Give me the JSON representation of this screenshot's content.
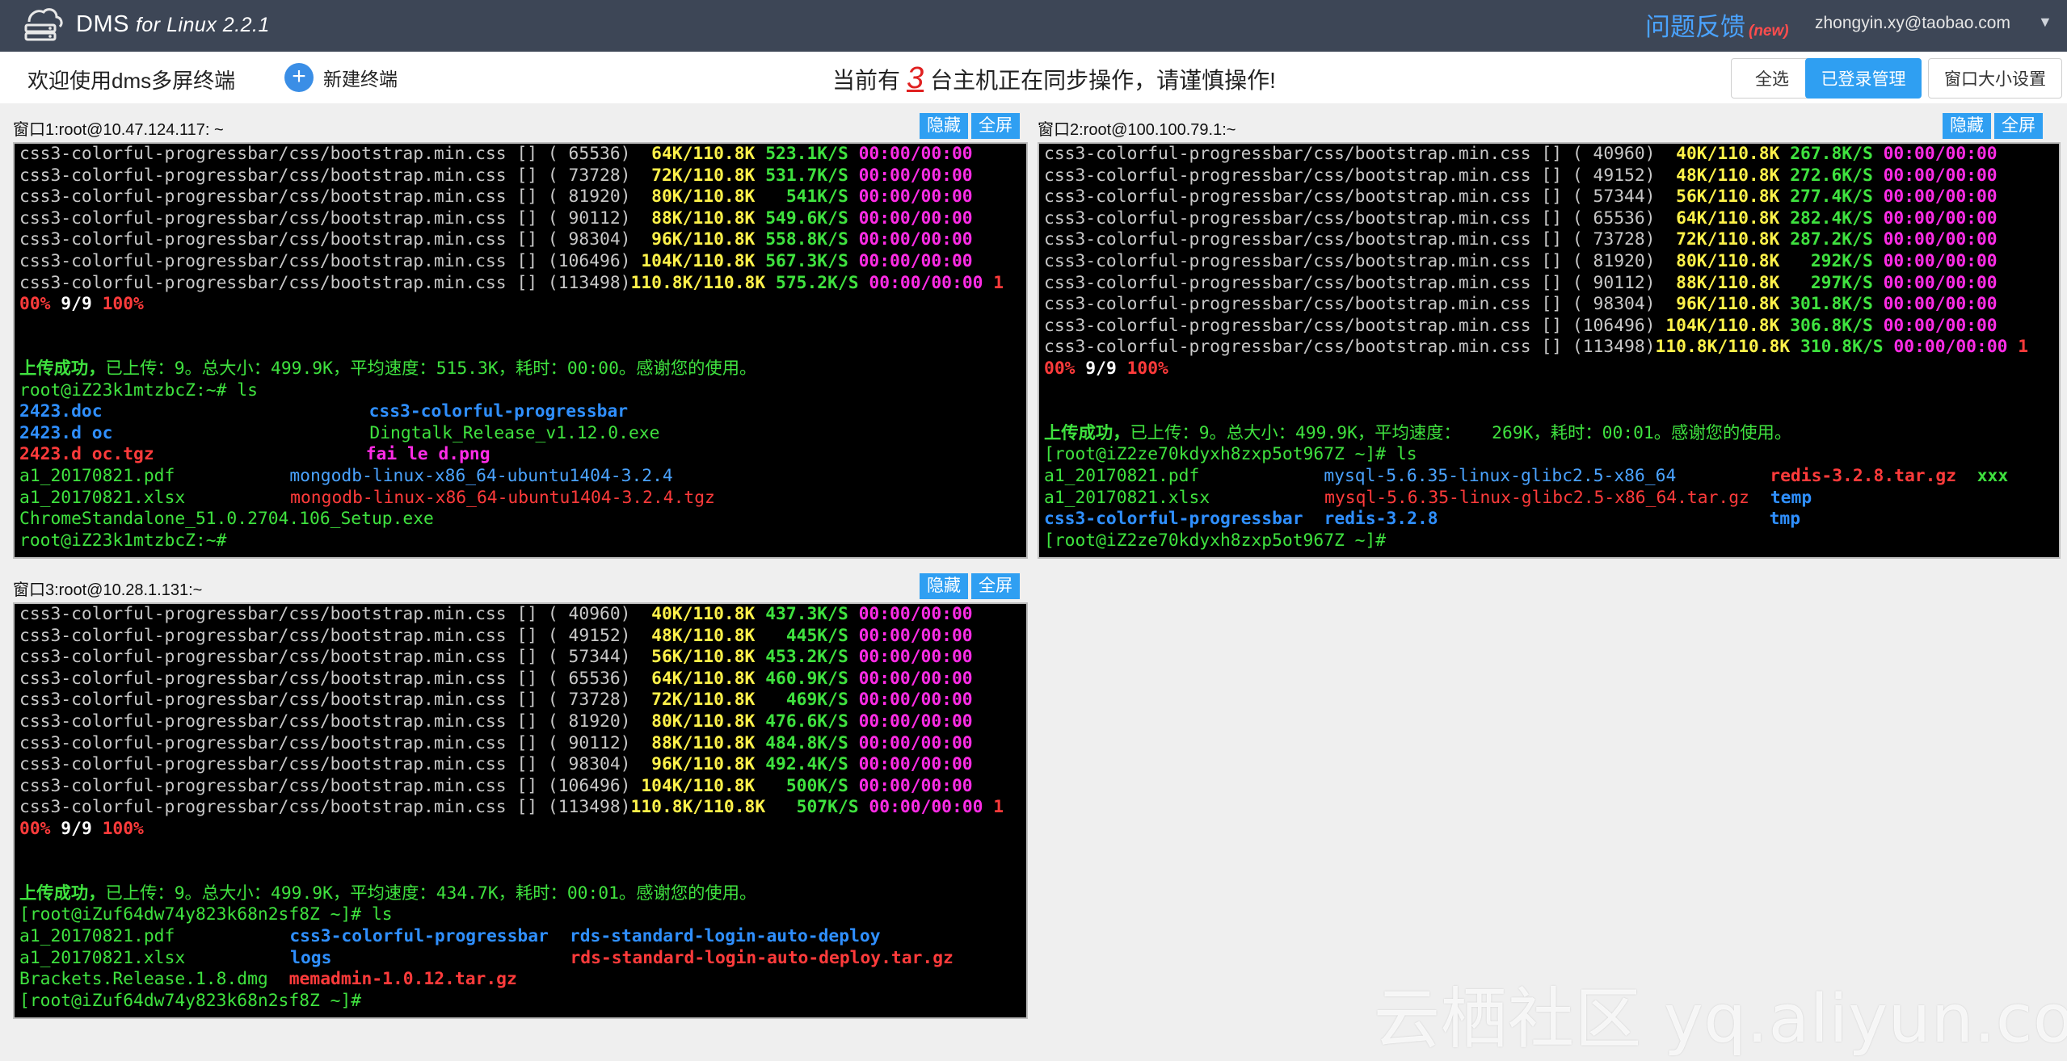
{
  "app": {
    "title": "DMS",
    "subtitle": "for Linux 2.2.1",
    "feedback": "问题反馈",
    "feedback_badge": "(new)",
    "user": "zhongyin.xy@taobao.com",
    "user_caret": "▼"
  },
  "toolbar": {
    "welcome": "欢迎使用dms多屏终端",
    "new_terminal_icon": "+",
    "new_terminal": "新建终端",
    "sync_prefix": "当前有",
    "sync_count": "3",
    "sync_suffix": "台主机正在同步操作，请谨慎操作!",
    "select_all": "全选",
    "login_manage": "已登录管理",
    "window_size": "窗口大小设置"
  },
  "panes": [
    {
      "title": "窗口1:root@10.47.124.117: ~",
      "hide": "隐藏",
      "fullscreen": "全屏",
      "lines": [
        [
          [
            "gray",
            "css3-colorful-progressbar/css/bootstrap.min.css [] ( 65536)  "
          ],
          [
            "y",
            "64K/110.8K "
          ],
          [
            "g",
            "523.1K/S "
          ],
          [
            "m",
            "00:00/00:00"
          ]
        ],
        [
          [
            "gray",
            "css3-colorful-progressbar/css/bootstrap.min.css [] ( 73728)  "
          ],
          [
            "y",
            "72K/110.8K "
          ],
          [
            "g",
            "531.7K/S "
          ],
          [
            "m",
            "00:00/00:00"
          ]
        ],
        [
          [
            "gray",
            "css3-colorful-progressbar/css/bootstrap.min.css [] ( 81920)  "
          ],
          [
            "y",
            "80K/110.8K "
          ],
          [
            "g",
            "  541K/S "
          ],
          [
            "m",
            "00:00/00:00"
          ]
        ],
        [
          [
            "gray",
            "css3-colorful-progressbar/css/bootstrap.min.css [] ( 90112)  "
          ],
          [
            "y",
            "88K/110.8K "
          ],
          [
            "g",
            "549.6K/S "
          ],
          [
            "m",
            "00:00/00:00"
          ]
        ],
        [
          [
            "gray",
            "css3-colorful-progressbar/css/bootstrap.min.css [] ( 98304)  "
          ],
          [
            "y",
            "96K/110.8K "
          ],
          [
            "g",
            "558.8K/S "
          ],
          [
            "m",
            "00:00/00:00"
          ]
        ],
        [
          [
            "gray",
            "css3-colorful-progressbar/css/bootstrap.min.css [] (106496) "
          ],
          [
            "y",
            "104K/110.8K "
          ],
          [
            "g",
            "567.3K/S "
          ],
          [
            "m",
            "00:00/00:00"
          ]
        ],
        [
          [
            "gray",
            "css3-colorful-progressbar/css/bootstrap.min.css [] (113498)"
          ],
          [
            "y",
            "110.8K/110.8K "
          ],
          [
            "g",
            "575.2K/S "
          ],
          [
            "m",
            "00:00/00:00 "
          ],
          [
            "r",
            "1"
          ]
        ],
        [
          [
            "r",
            "00% "
          ],
          [
            "w",
            "9/9 "
          ],
          [
            "r",
            "100%"
          ]
        ],
        [],
        [],
        [
          [
            "g",
            "上传成功，"
          ],
          [
            "gr",
            "已上传：9。总大小：499.9K，平均速度：515.3K，耗时：00:00。感谢您的使用。"
          ]
        ],
        [
          [
            "gr",
            "root@iZ23k1mtzbcZ:~# ls"
          ]
        ],
        [
          [
            "b",
            "2423.doc"
          ],
          [
            "sp",
            "",
            "330"
          ],
          [
            "b",
            "css3-colorful-progressbar"
          ]
        ],
        [
          [
            "b",
            "2423.d oc"
          ],
          [
            "sp",
            "",
            "318"
          ],
          [
            "gr",
            "Dingtalk_Release_v1.12.0.exe"
          ]
        ],
        [
          [
            "r",
            "2423.d oc.tgz"
          ],
          [
            "sp",
            "",
            "262"
          ],
          [
            "m",
            "fai le d.png"
          ]
        ],
        [
          [
            "gr",
            "a1_20170821.pdf"
          ],
          [
            "sp",
            "",
            "142"
          ],
          [
            "lb",
            "mongodb-linux-x86_64-ubuntu1404-3.2.4"
          ]
        ],
        [
          [
            "gr",
            "a1_20170821.xlsx"
          ],
          [
            "sp",
            "",
            "130"
          ],
          [
            "lr",
            "mongodb-linux-x86_64-ubuntu1404-3.2.4.tgz"
          ]
        ],
        [
          [
            "gr",
            "ChromeStandalone_51.0.2704.106_Setup.exe"
          ]
        ],
        [
          [
            "gr",
            "root@iZ23k1mtzbcZ:~# "
          ]
        ]
      ]
    },
    {
      "title": "窗口2:root@100.100.79.1:~",
      "hide": "隐藏",
      "fullscreen": "全屏",
      "lines": [
        [
          [
            "gray",
            "css3-colorful-progressbar/css/bootstrap.min.css [] ( 40960)  "
          ],
          [
            "y",
            "40K/110.8K "
          ],
          [
            "g",
            "267.8K/S "
          ],
          [
            "m",
            "00:00/00:00"
          ]
        ],
        [
          [
            "gray",
            "css3-colorful-progressbar/css/bootstrap.min.css [] ( 49152)  "
          ],
          [
            "y",
            "48K/110.8K "
          ],
          [
            "g",
            "272.6K/S "
          ],
          [
            "m",
            "00:00/00:00"
          ]
        ],
        [
          [
            "gray",
            "css3-colorful-progressbar/css/bootstrap.min.css [] ( 57344)  "
          ],
          [
            "y",
            "56K/110.8K "
          ],
          [
            "g",
            "277.4K/S "
          ],
          [
            "m",
            "00:00/00:00"
          ]
        ],
        [
          [
            "gray",
            "css3-colorful-progressbar/css/bootstrap.min.css [] ( 65536)  "
          ],
          [
            "y",
            "64K/110.8K "
          ],
          [
            "g",
            "282.4K/S "
          ],
          [
            "m",
            "00:00/00:00"
          ]
        ],
        [
          [
            "gray",
            "css3-colorful-progressbar/css/bootstrap.min.css [] ( 73728)  "
          ],
          [
            "y",
            "72K/110.8K "
          ],
          [
            "g",
            "287.2K/S "
          ],
          [
            "m",
            "00:00/00:00"
          ]
        ],
        [
          [
            "gray",
            "css3-colorful-progressbar/css/bootstrap.min.css [] ( 81920)  "
          ],
          [
            "y",
            "80K/110.8K "
          ],
          [
            "g",
            "  292K/S "
          ],
          [
            "m",
            "00:00/00:00"
          ]
        ],
        [
          [
            "gray",
            "css3-colorful-progressbar/css/bootstrap.min.css [] ( 90112)  "
          ],
          [
            "y",
            "88K/110.8K "
          ],
          [
            "g",
            "  297K/S "
          ],
          [
            "m",
            "00:00/00:00"
          ]
        ],
        [
          [
            "gray",
            "css3-colorful-progressbar/css/bootstrap.min.css [] ( 98304)  "
          ],
          [
            "y",
            "96K/110.8K "
          ],
          [
            "g",
            "301.8K/S "
          ],
          [
            "m",
            "00:00/00:00"
          ]
        ],
        [
          [
            "gray",
            "css3-colorful-progressbar/css/bootstrap.min.css [] (106496) "
          ],
          [
            "y",
            "104K/110.8K "
          ],
          [
            "g",
            "306.8K/S "
          ],
          [
            "m",
            "00:00/00:00"
          ]
        ],
        [
          [
            "gray",
            "css3-colorful-progressbar/css/bootstrap.min.css [] (113498)"
          ],
          [
            "y",
            "110.8K/110.8K "
          ],
          [
            "g",
            "310.8K/S "
          ],
          [
            "m",
            "00:00/00:00 "
          ],
          [
            "r",
            "1"
          ]
        ],
        [
          [
            "r",
            "00% "
          ],
          [
            "w",
            "9/9 "
          ],
          [
            "r",
            "100%"
          ]
        ],
        [],
        [],
        [
          [
            "g",
            "上传成功，"
          ],
          [
            "gr",
            "已上传：9。总大小：499.9K，平均速度：   269K，耗时：00:01。感谢您的使用。"
          ]
        ],
        [
          [
            "gr",
            "[root@iZ2ze70kdyxh8zxp5ot967Z ~]# ls"
          ]
        ],
        [
          [
            "gr",
            "a1_20170821.pdf"
          ],
          [
            "sp",
            "",
            "154"
          ],
          [
            "lb",
            "mysql-5.6.35-linux-glibc2.5-x86_64"
          ],
          [
            "sp",
            "",
            "116"
          ],
          [
            "r",
            "redis-3.2.8.tar.gz  "
          ],
          [
            "g",
            "xxx"
          ]
        ],
        [
          [
            "gr",
            "a1_20170821.xlsx"
          ],
          [
            "sp",
            "",
            "142"
          ],
          [
            "lr",
            "mysql-5.6.35-linux-glibc2.5-x86_64.tar.gz"
          ],
          [
            "sp",
            "",
            "26"
          ],
          [
            "b",
            "temp"
          ]
        ],
        [
          [
            "b",
            "css3-colorful-progressbar"
          ],
          [
            "sp",
            "",
            "26"
          ],
          [
            "b",
            "redis-3.2.8"
          ],
          [
            "sp",
            "",
            "410"
          ],
          [
            "b",
            "tmp"
          ]
        ],
        [
          [
            "gr",
            "[root@iZ2ze70kdyxh8zxp5ot967Z ~]# "
          ]
        ]
      ]
    },
    {
      "title": "窗口3:root@10.28.1.131:~",
      "hide": "隐藏",
      "fullscreen": "全屏",
      "lines": [
        [
          [
            "gray",
            "css3-colorful-progressbar/css/bootstrap.min.css [] ( 40960)  "
          ],
          [
            "y",
            "40K/110.8K "
          ],
          [
            "g",
            "437.3K/S "
          ],
          [
            "m",
            "00:00/00:00"
          ]
        ],
        [
          [
            "gray",
            "css3-colorful-progressbar/css/bootstrap.min.css [] ( 49152)  "
          ],
          [
            "y",
            "48K/110.8K "
          ],
          [
            "g",
            "  445K/S "
          ],
          [
            "m",
            "00:00/00:00"
          ]
        ],
        [
          [
            "gray",
            "css3-colorful-progressbar/css/bootstrap.min.css [] ( 57344)  "
          ],
          [
            "y",
            "56K/110.8K "
          ],
          [
            "g",
            "453.2K/S "
          ],
          [
            "m",
            "00:00/00:00"
          ]
        ],
        [
          [
            "gray",
            "css3-colorful-progressbar/css/bootstrap.min.css [] ( 65536)  "
          ],
          [
            "y",
            "64K/110.8K "
          ],
          [
            "g",
            "460.9K/S "
          ],
          [
            "m",
            "00:00/00:00"
          ]
        ],
        [
          [
            "gray",
            "css3-colorful-progressbar/css/bootstrap.min.css [] ( 73728)  "
          ],
          [
            "y",
            "72K/110.8K "
          ],
          [
            "g",
            "  469K/S "
          ],
          [
            "m",
            "00:00/00:00"
          ]
        ],
        [
          [
            "gray",
            "css3-colorful-progressbar/css/bootstrap.min.css [] ( 81920)  "
          ],
          [
            "y",
            "80K/110.8K "
          ],
          [
            "g",
            "476.6K/S "
          ],
          [
            "m",
            "00:00/00:00"
          ]
        ],
        [
          [
            "gray",
            "css3-colorful-progressbar/css/bootstrap.min.css [] ( 90112)  "
          ],
          [
            "y",
            "88K/110.8K "
          ],
          [
            "g",
            "484.8K/S "
          ],
          [
            "m",
            "00:00/00:00"
          ]
        ],
        [
          [
            "gray",
            "css3-colorful-progressbar/css/bootstrap.min.css [] ( 98304)  "
          ],
          [
            "y",
            "96K/110.8K "
          ],
          [
            "g",
            "492.4K/S "
          ],
          [
            "m",
            "00:00/00:00"
          ]
        ],
        [
          [
            "gray",
            "css3-colorful-progressbar/css/bootstrap.min.css [] (106496) "
          ],
          [
            "y",
            "104K/110.8K "
          ],
          [
            "g",
            "  500K/S "
          ],
          [
            "m",
            "00:00/00:00"
          ]
        ],
        [
          [
            "gray",
            "css3-colorful-progressbar/css/bootstrap.min.css [] (113498)"
          ],
          [
            "y",
            "110.8K/110.8K "
          ],
          [
            "g",
            "  507K/S "
          ],
          [
            "m",
            "00:00/00:00 "
          ],
          [
            "r",
            "1"
          ]
        ],
        [
          [
            "r",
            "00% "
          ],
          [
            "w",
            "9/9 "
          ],
          [
            "r",
            "100%"
          ]
        ],
        [],
        [],
        [
          [
            "g",
            "上传成功，"
          ],
          [
            "gr",
            "已上传：9。总大小：499.9K，平均速度：434.7K，耗时：00:01。感谢您的使用。"
          ]
        ],
        [
          [
            "gr",
            "[root@iZuf64dw74y823k68n2sf8Z ~]# ls"
          ]
        ],
        [
          [
            "gr",
            "a1_20170821.pdf"
          ],
          [
            "sp",
            "",
            "142"
          ],
          [
            "b",
            "css3-colorful-progressbar"
          ],
          [
            "sp",
            "",
            "26"
          ],
          [
            "b",
            "rds-standard-login-auto-deploy"
          ]
        ],
        [
          [
            "gr",
            "a1_20170821.xlsx"
          ],
          [
            "sp",
            "",
            "130"
          ],
          [
            "b",
            "logs"
          ],
          [
            "sp",
            "",
            "295"
          ],
          [
            "r",
            "rds-standard-login-auto-deploy.tar.gz"
          ]
        ],
        [
          [
            "gr",
            "Brackets.Release.1.8.dmg"
          ],
          [
            "sp",
            "",
            "26"
          ],
          [
            "r",
            "memadmin-1.0.12.tar.gz"
          ]
        ],
        [
          [
            "gr",
            "[root@iZuf64dw74y823k68n2sf8Z ~]# "
          ]
        ]
      ]
    }
  ],
  "watermark": "云栖社区 yq.aliyun.com",
  "colors": {
    "topbar": "#3d4656",
    "accent": "#2f9ff2",
    "terminal_bg": "#000000",
    "warning": "#e02020"
  }
}
